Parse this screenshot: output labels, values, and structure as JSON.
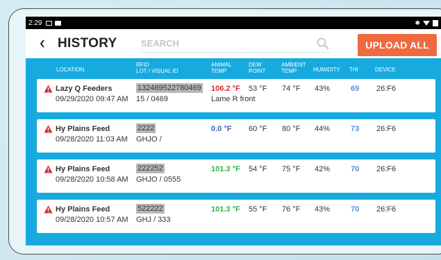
{
  "status_bar": {
    "time": "2:29"
  },
  "header": {
    "title": "HISTORY",
    "search_placeholder": "SEARCH",
    "upload_label": "UPLOAD ALL"
  },
  "columns": {
    "location": "LOCATION",
    "rfid_line1": "RFID",
    "rfid_line2": "LOT / VISUAL ID",
    "animal_line1": "ANIMAL",
    "animal_line2": "TEMP",
    "dew_line1": "DEW",
    "dew_line2": "POINT",
    "ambient_line1": "AMBIENT",
    "ambient_line2": "TEMP",
    "humidity": "HUMIDITY",
    "thi": "THI",
    "device": "DEVICE"
  },
  "colors": {
    "accent": "#17aadf",
    "upload": "#ef6a3f",
    "temp_high": "#d8262e",
    "temp_normal": "#2db34a",
    "temp_low": "#3d5fb0",
    "thi": "#5b8fd6",
    "warning": "#d8262e"
  },
  "rows": [
    {
      "location": "Lazy Q Feeders",
      "datetime": "09/29/2020 09:47 AM",
      "rfid": "132469522780469",
      "lot": "15 / 0469",
      "animal_temp": "106.2 °F",
      "temp_status": "high",
      "note": "Lame R front",
      "dew_point": "53 °F",
      "ambient_temp": "74 °F",
      "humidity": "43%",
      "thi": "69",
      "device": "26:F6"
    },
    {
      "location": "Hy Plains Feed",
      "datetime": "09/28/2020 11:03 AM",
      "rfid": "2222",
      "lot": "GHJO /",
      "animal_temp": "0.0 °F",
      "temp_status": "low",
      "note": "",
      "dew_point": "60 °F",
      "ambient_temp": "80 °F",
      "humidity": "44%",
      "thi": "73",
      "device": "26:F6"
    },
    {
      "location": "Hy Plains Feed",
      "datetime": "09/28/2020 10:58 AM",
      "rfid": "222252",
      "lot": "GHJO / 0555",
      "animal_temp": "101.3 °F",
      "temp_status": "normal",
      "note": "",
      "dew_point": "54 °F",
      "ambient_temp": "75 °F",
      "humidity": "42%",
      "thi": "70",
      "device": "26:F6"
    },
    {
      "location": "Hy Plains Feed",
      "datetime": "09/28/2020 10:57 AM",
      "rfid": "522222",
      "lot": "GHJ / 333",
      "animal_temp": "101.3 °F",
      "temp_status": "normal",
      "note": "",
      "dew_point": "55 °F",
      "ambient_temp": "76 °F",
      "humidity": "43%",
      "thi": "70",
      "device": "26:F6"
    }
  ]
}
